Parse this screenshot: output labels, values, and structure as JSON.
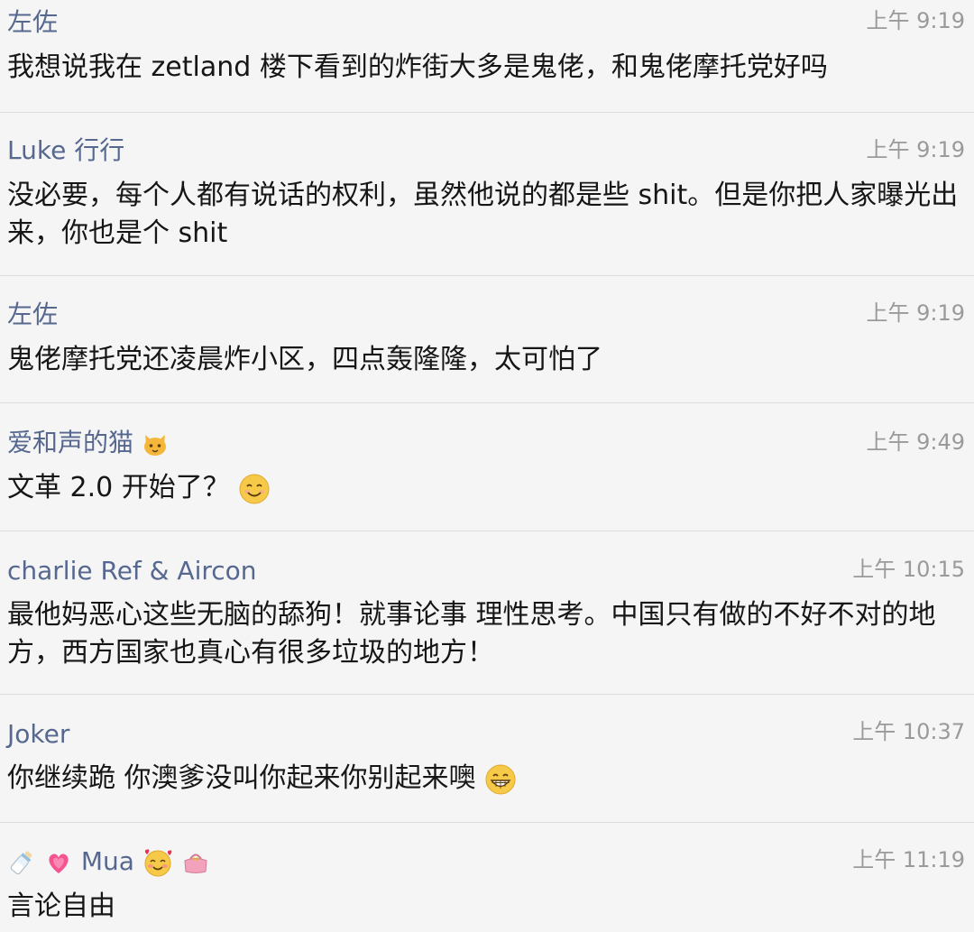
{
  "messages": [
    {
      "sender": "左佐",
      "time": "上午 9:19",
      "text": "我想说我在 zetland 楼下看到的炸街大多是鬼佬，和鬼佬摩托党好吗"
    },
    {
      "sender": "Luke 行行",
      "time": "上午 9:19",
      "text": "没必要，每个人都有说话的权利，虽然他说的都是些 shit。但是你把人家曝光出来，你也是个 shit"
    },
    {
      "sender": "左佐",
      "time": "上午 9:19",
      "text": "鬼佬摩托党还凌晨炸小区，四点轰隆隆，太可怕了"
    },
    {
      "sender": "爱和声的猫",
      "sender_icon": "cat-face-icon",
      "time": "上午 9:49",
      "text": "文革 2.0 开始了？",
      "text_icon": "smiling-face-icon"
    },
    {
      "sender": "charlie Ref & Aircon",
      "time": "上午 10:15",
      "text": "最他妈恶心这些无脑的舔狗！就事论事 理性思考。中国只有做的不好不对的地方，西方国家也真心有很多垃圾的地方！"
    },
    {
      "sender": "Joker",
      "time": "上午 10:37",
      "text": "你继续跪 你澳爹没叫你起来你别起来噢",
      "text_icon": "grinning-face-icon"
    },
    {
      "sender": "Mua",
      "sender_prefix_icons": [
        "baby-bottle-icon",
        "growing-heart-icon"
      ],
      "sender_suffix_icons": [
        "smiling-face-with-hearts-icon",
        "purse-icon"
      ],
      "time": "上午 11:19",
      "text": "言论自由"
    }
  ]
}
